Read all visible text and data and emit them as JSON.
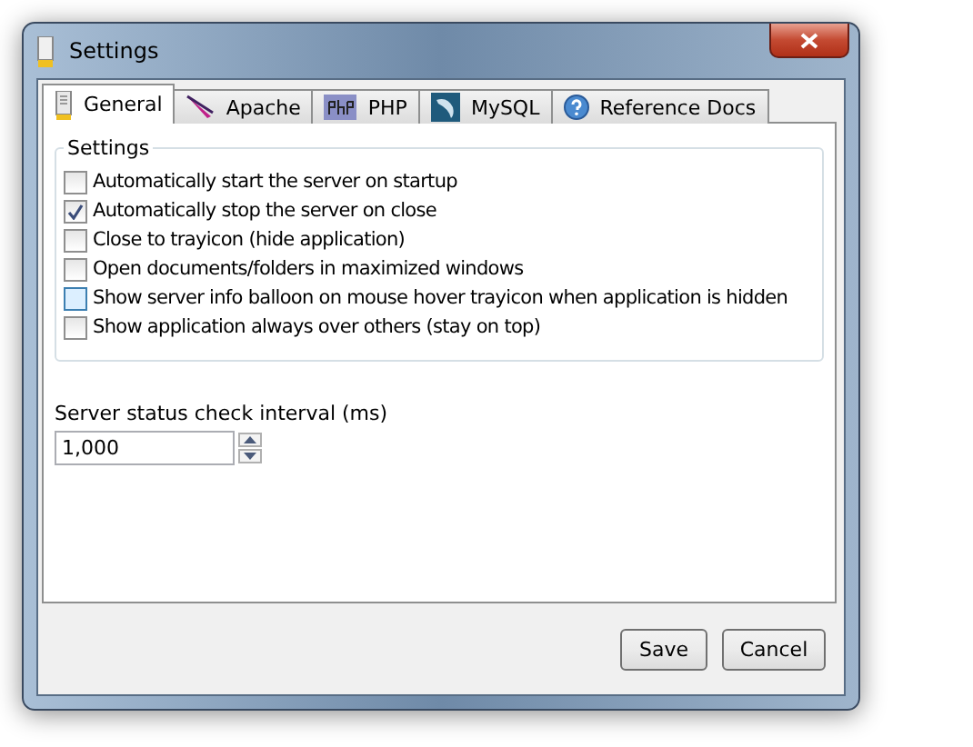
{
  "window": {
    "title": "Settings"
  },
  "tabs": [
    {
      "label": "General",
      "selected": true,
      "kind": "server"
    },
    {
      "label": "Apache",
      "selected": false,
      "kind": "feather"
    },
    {
      "label": "PHP",
      "selected": false,
      "kind": "php"
    },
    {
      "label": "MySQL",
      "selected": false,
      "kind": "dolphin"
    },
    {
      "label": "Reference Docs",
      "selected": false,
      "kind": "help"
    }
  ],
  "group": {
    "title": "Settings"
  },
  "options": [
    {
      "label": "Automatically start the server on startup",
      "checked": false,
      "hovered": false
    },
    {
      "label": "Automatically stop the server on close",
      "checked": true,
      "hovered": false
    },
    {
      "label": "Close to trayicon (hide application)",
      "checked": false,
      "hovered": false
    },
    {
      "label": "Open documents/folders in maximized windows",
      "checked": false,
      "hovered": false
    },
    {
      "label": "Show server info balloon on mouse hover trayicon when application is hidden",
      "checked": false,
      "hovered": true
    },
    {
      "label": "Show application always over others (stay on top)",
      "checked": false,
      "hovered": false
    }
  ],
  "interval": {
    "label": "Server status check interval (ms)",
    "value": "1,000"
  },
  "buttons": [
    "Save",
    "Cancel"
  ]
}
